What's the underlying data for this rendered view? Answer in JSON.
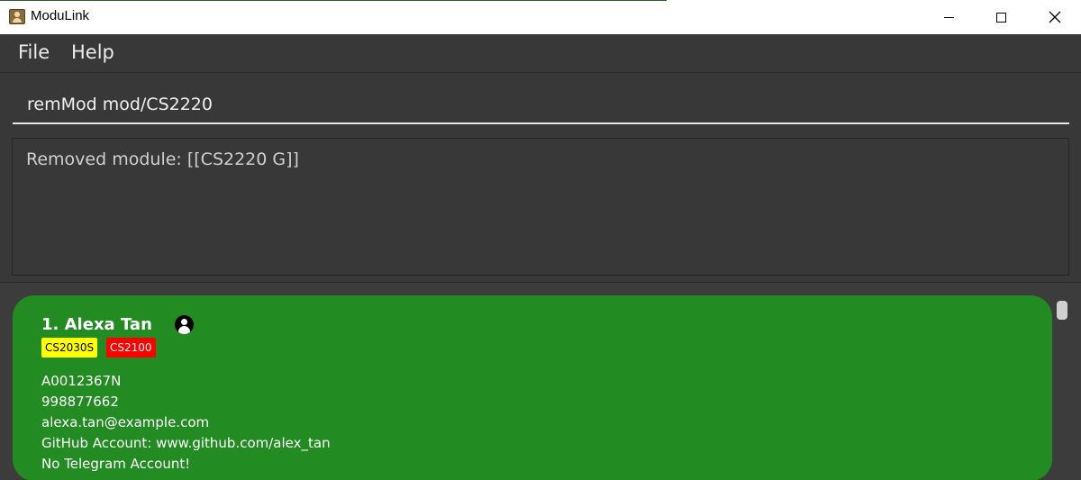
{
  "window": {
    "title": "ModuLink",
    "controls": {
      "minimize": "minimize",
      "maximize": "maximize",
      "close": "✕"
    }
  },
  "menu": {
    "file": "File",
    "help": "Help"
  },
  "command": {
    "value": "remMod mod/CS2220"
  },
  "result": {
    "text": "Removed module: [[CS2220 G]]"
  },
  "persons": [
    {
      "name": "1. Alexa Tan",
      "tags": [
        {
          "label": "CS2030S",
          "color": "#ffff00"
        },
        {
          "label": "CS2100",
          "color": "#ff0000"
        }
      ],
      "student_id": "A0012367N",
      "phone": "998877662",
      "email": "alexa.tan@example.com",
      "github": "GitHub Account: www.github.com/alex_tan",
      "telegram": "No Telegram Account!",
      "card_color": "#228b22",
      "icon": "person-icon"
    }
  ]
}
